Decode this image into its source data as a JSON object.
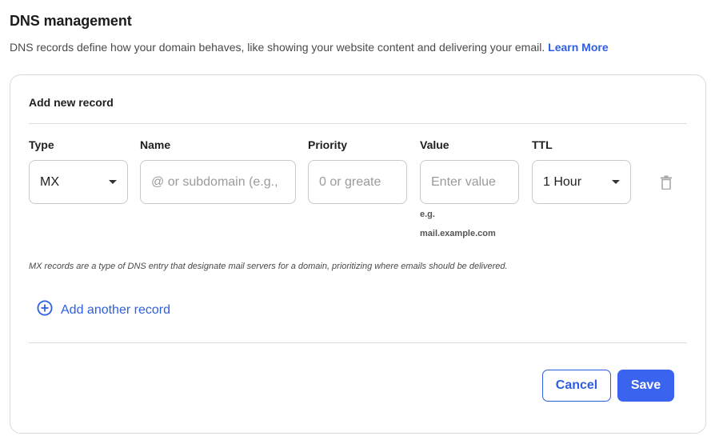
{
  "header": {
    "title": "DNS management",
    "description": "DNS records define how your domain behaves, like showing your website content and delivering your email.",
    "learn_more": "Learn More"
  },
  "card": {
    "heading": "Add new record",
    "columns": {
      "type": "Type",
      "name": "Name",
      "priority": "Priority",
      "value": "Value",
      "ttl": "TTL"
    },
    "row": {
      "type_value": "MX",
      "name_placeholder": "@ or subdomain (e.g.,",
      "priority_placeholder": "0 or greate",
      "value_placeholder": "Enter value",
      "ttl_value": "1 Hour"
    },
    "value_hint_line1": "e.g.",
    "value_hint_line2": "mail.example.com",
    "note": "MX records are a type of DNS entry that designate mail servers for a domain, prioritizing where emails should be delivered.",
    "add_another": "Add another record",
    "cancel": "Cancel",
    "save": "Save"
  },
  "colors": {
    "accent": "#2e5fe0",
    "primary_button": "#3a64f0",
    "border": "#c9c9c9"
  },
  "icons": {
    "delete": "trash-icon",
    "add": "plus-circle-icon",
    "dropdown": "chevron-down-icon"
  }
}
